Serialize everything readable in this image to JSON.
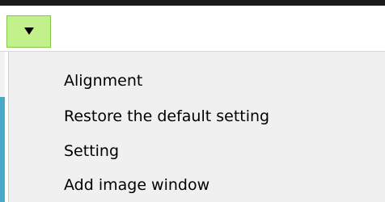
{
  "toolbar": {
    "dropdown_icon": "triangle-down-icon",
    "button_color": "#c2f08a"
  },
  "menu": {
    "items": [
      {
        "label": "Alignment"
      },
      {
        "label": "Restore the default setting"
      },
      {
        "label": "Setting"
      },
      {
        "label": "Add image window"
      }
    ]
  }
}
